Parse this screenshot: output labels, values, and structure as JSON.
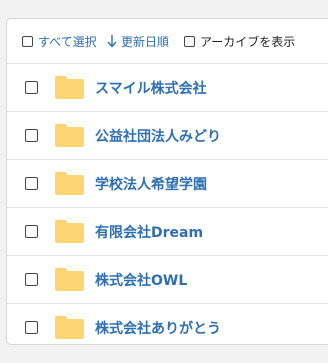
{
  "toolbar": {
    "select_all_label": "すべて選択",
    "sort_label": "更新日順",
    "archive_label": "アーカイブを表示"
  },
  "colors": {
    "link": "#2f6fb1",
    "folder": "#fdd575",
    "border": "#e3e3e3"
  },
  "folders": [
    {
      "label": "スマイル株式会社"
    },
    {
      "label": "公益社団法人みどり"
    },
    {
      "label": "学校法人希望学園"
    },
    {
      "label": "有限会社Dream"
    },
    {
      "label": "株式会社OWL"
    },
    {
      "label": "株式会社ありがとう"
    }
  ]
}
